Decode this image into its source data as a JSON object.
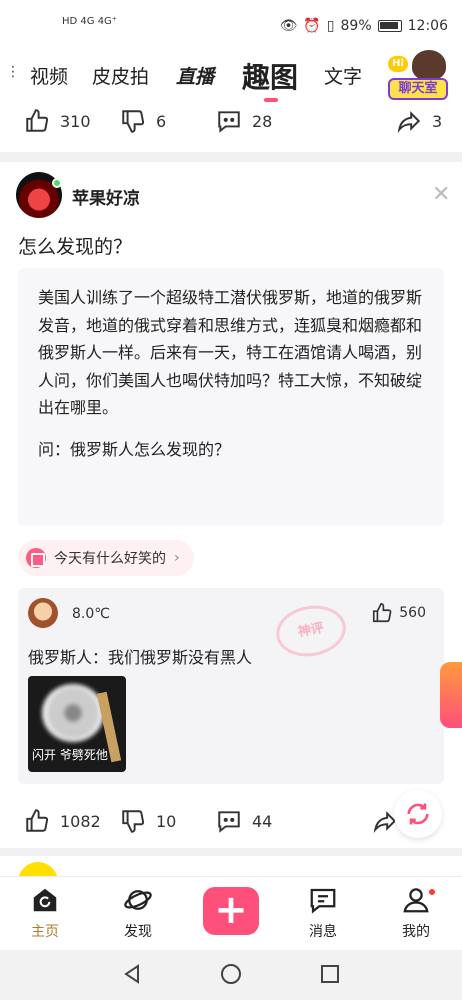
{
  "status_bar": {
    "left_text": "HD 4G 4G⁺",
    "battery": "89%",
    "time": "12:06"
  },
  "top_nav": {
    "items": [
      "视频",
      "皮皮拍",
      "直播",
      "趣图",
      "文字"
    ],
    "active_index": 3,
    "chat_room_badge": "Hi",
    "chat_room_label": "聊天室"
  },
  "prev_post_actions": {
    "likes": "310",
    "dislikes": "6",
    "comments": "28",
    "shares": "3"
  },
  "post": {
    "author": "苹果好凉",
    "title": "怎么发现的？",
    "quote_body": "美国人训练了一个超级特工潜伏俄罗斯，地道的俄罗斯发音，地道的俄式穿着和思维方式，连狐臭和烟瘾都和俄罗斯人一样。后来有一天，特工在酒馆请人喝酒，别人问，你们美国人也喝伏特加吗？特工大惊，不知破绽出在哪里。",
    "quote_question": "问：俄罗斯人怎么发现的？",
    "tag": "今天有什么好笑的",
    "top_comment": {
      "user": "8.0℃",
      "likes": "560",
      "text": "俄罗斯人：我们俄罗斯没有黑人",
      "stamp": "神评",
      "image_caption": "闪开 爷劈死他"
    },
    "actions": {
      "likes": "1082",
      "dislikes": "10",
      "comments": "44"
    }
  },
  "bottom_bar": {
    "tabs": [
      "主页",
      "发现",
      "消息",
      "我的"
    ],
    "active_index": 0
  }
}
